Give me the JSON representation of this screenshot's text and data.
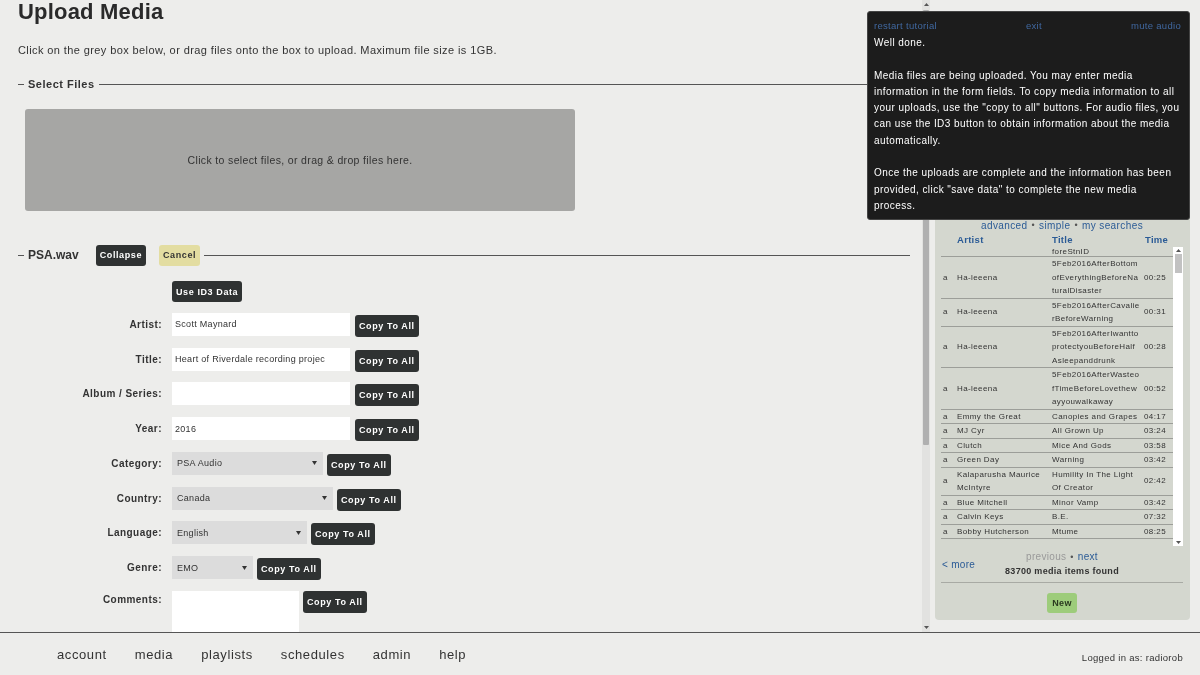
{
  "page": {
    "title": "Upload Media",
    "instructions": "Click on the grey box below, or drag files onto the box to upload. Maximum file size is 1GB."
  },
  "select_files": {
    "legend": "Select Files",
    "drop_zone": "Click to select files, or drag & drop files here."
  },
  "upload": {
    "file_name": "PSA.wav",
    "buttons": [
      {
        "label": "Collapse",
        "kind": "dark"
      },
      {
        "label": "Cancel",
        "kind": "cancel"
      }
    ],
    "id3_button": "Use ID3 Data",
    "fields": [
      {
        "label": "Artist:",
        "kind": "text",
        "value": "Scott Maynard",
        "button": "Copy To All"
      },
      {
        "label": "Title:",
        "kind": "text",
        "value": "Heart of Riverdale recording projec",
        "button": "Copy To All"
      },
      {
        "label": "Album / Series:",
        "kind": "text",
        "button": "Copy To All"
      },
      {
        "label": "Year:",
        "kind": "text",
        "value": "2016",
        "button": "Copy To All"
      },
      {
        "label": "Category:",
        "kind": "select",
        "value": "PSA Audio",
        "button": "Copy To All"
      },
      {
        "label": "Country:",
        "kind": "select",
        "value": "Canada",
        "button": "Copy To All"
      },
      {
        "label": "Language:",
        "kind": "select",
        "value": "English",
        "button": "Copy To All"
      },
      {
        "label": "Genre:",
        "kind": "select",
        "value": "EMO",
        "button": "Copy To All"
      },
      {
        "label": "Comments:",
        "kind": "textarea",
        "button": "Copy To All"
      }
    ]
  },
  "tutorial": {
    "links": [
      "restart tutorial",
      "exit",
      "mute audio"
    ],
    "paragraphs": [
      "Well done.",
      "Media files are being uploaded. You may enter media information in the form fields. To copy media information to all your uploads, use the \"copy to all\" buttons. For audio files, you can use the ID3 button to obtain information about the media automatically.",
      "Once the uploads are complete and the information has been provided, click \"save data\" to complete the new media process."
    ]
  },
  "media_panel": {
    "search_links": {
      "links": [
        "advanced",
        "simple",
        "my searches"
      ],
      "separator": "•"
    },
    "columns": [
      "Artist",
      "Title",
      "Time"
    ],
    "rows": [
      {
        "title": "foreStnID"
      },
      {
        "column_1": "a",
        "artist": "Ha-leeena",
        "title": "5Feb2016AfterBottomofEverythingBeforeNaturalDisaster",
        "time": "00:25"
      },
      {
        "column_1": "a",
        "artist": "Ha-leeena",
        "title": "5Feb2016AfterCavalierBeforeWarning",
        "time": "00:31"
      },
      {
        "column_1": "a",
        "artist": "Ha-leeena",
        "title": "5Feb2016AfterIwanttoprotectyouBeforeHalfAsleepanddrunk",
        "time": "00:28"
      },
      {
        "column_1": "a",
        "artist": "Ha-leeena",
        "title": "5Feb2016AfterWasteofTimeBeforeLovethewayyouwalkaway",
        "time": "00:52"
      },
      {
        "column_1": "a",
        "artist": "Emmy the Great",
        "title": "Canopies and Grapes",
        "time": "04:17"
      },
      {
        "column_1": "a",
        "artist": "MJ Cyr",
        "title": "All Grown Up",
        "time": "03:24"
      },
      {
        "column_1": "a",
        "artist": "Clutch",
        "title": "Mice And Gods",
        "time": "03:58"
      },
      {
        "column_1": "a",
        "artist": "Green Day",
        "title": "Warning",
        "time": "03:42"
      },
      {
        "column_1": "a",
        "artist": "Kalaparusha Maurice McIntyre",
        "title": "Humility In The Light Of Creator",
        "time": "02:42"
      },
      {
        "column_1": "a",
        "artist": "Blue Mitchell",
        "title": "Minor Vamp",
        "time": "03:42"
      },
      {
        "column_1": "a",
        "artist": "Calvin Keys",
        "title": "B.E.",
        "time": "07:32"
      },
      {
        "column_1": "a",
        "artist": "Bobby Hutcherson",
        "title": "Mtume",
        "time": "08:25"
      }
    ],
    "pager": {
      "links": [
        {
          "label": "previous",
          "disabled": true
        },
        {
          "label": "next",
          "disabled": false
        }
      ],
      "separator": "•"
    },
    "more_link": "< more",
    "count": "83700 media items found",
    "new_button": "New"
  },
  "nav": {
    "items": [
      "account",
      "media",
      "playlists",
      "schedules",
      "admin",
      "help"
    ],
    "logged_in": "Logged in as: radiorob"
  }
}
